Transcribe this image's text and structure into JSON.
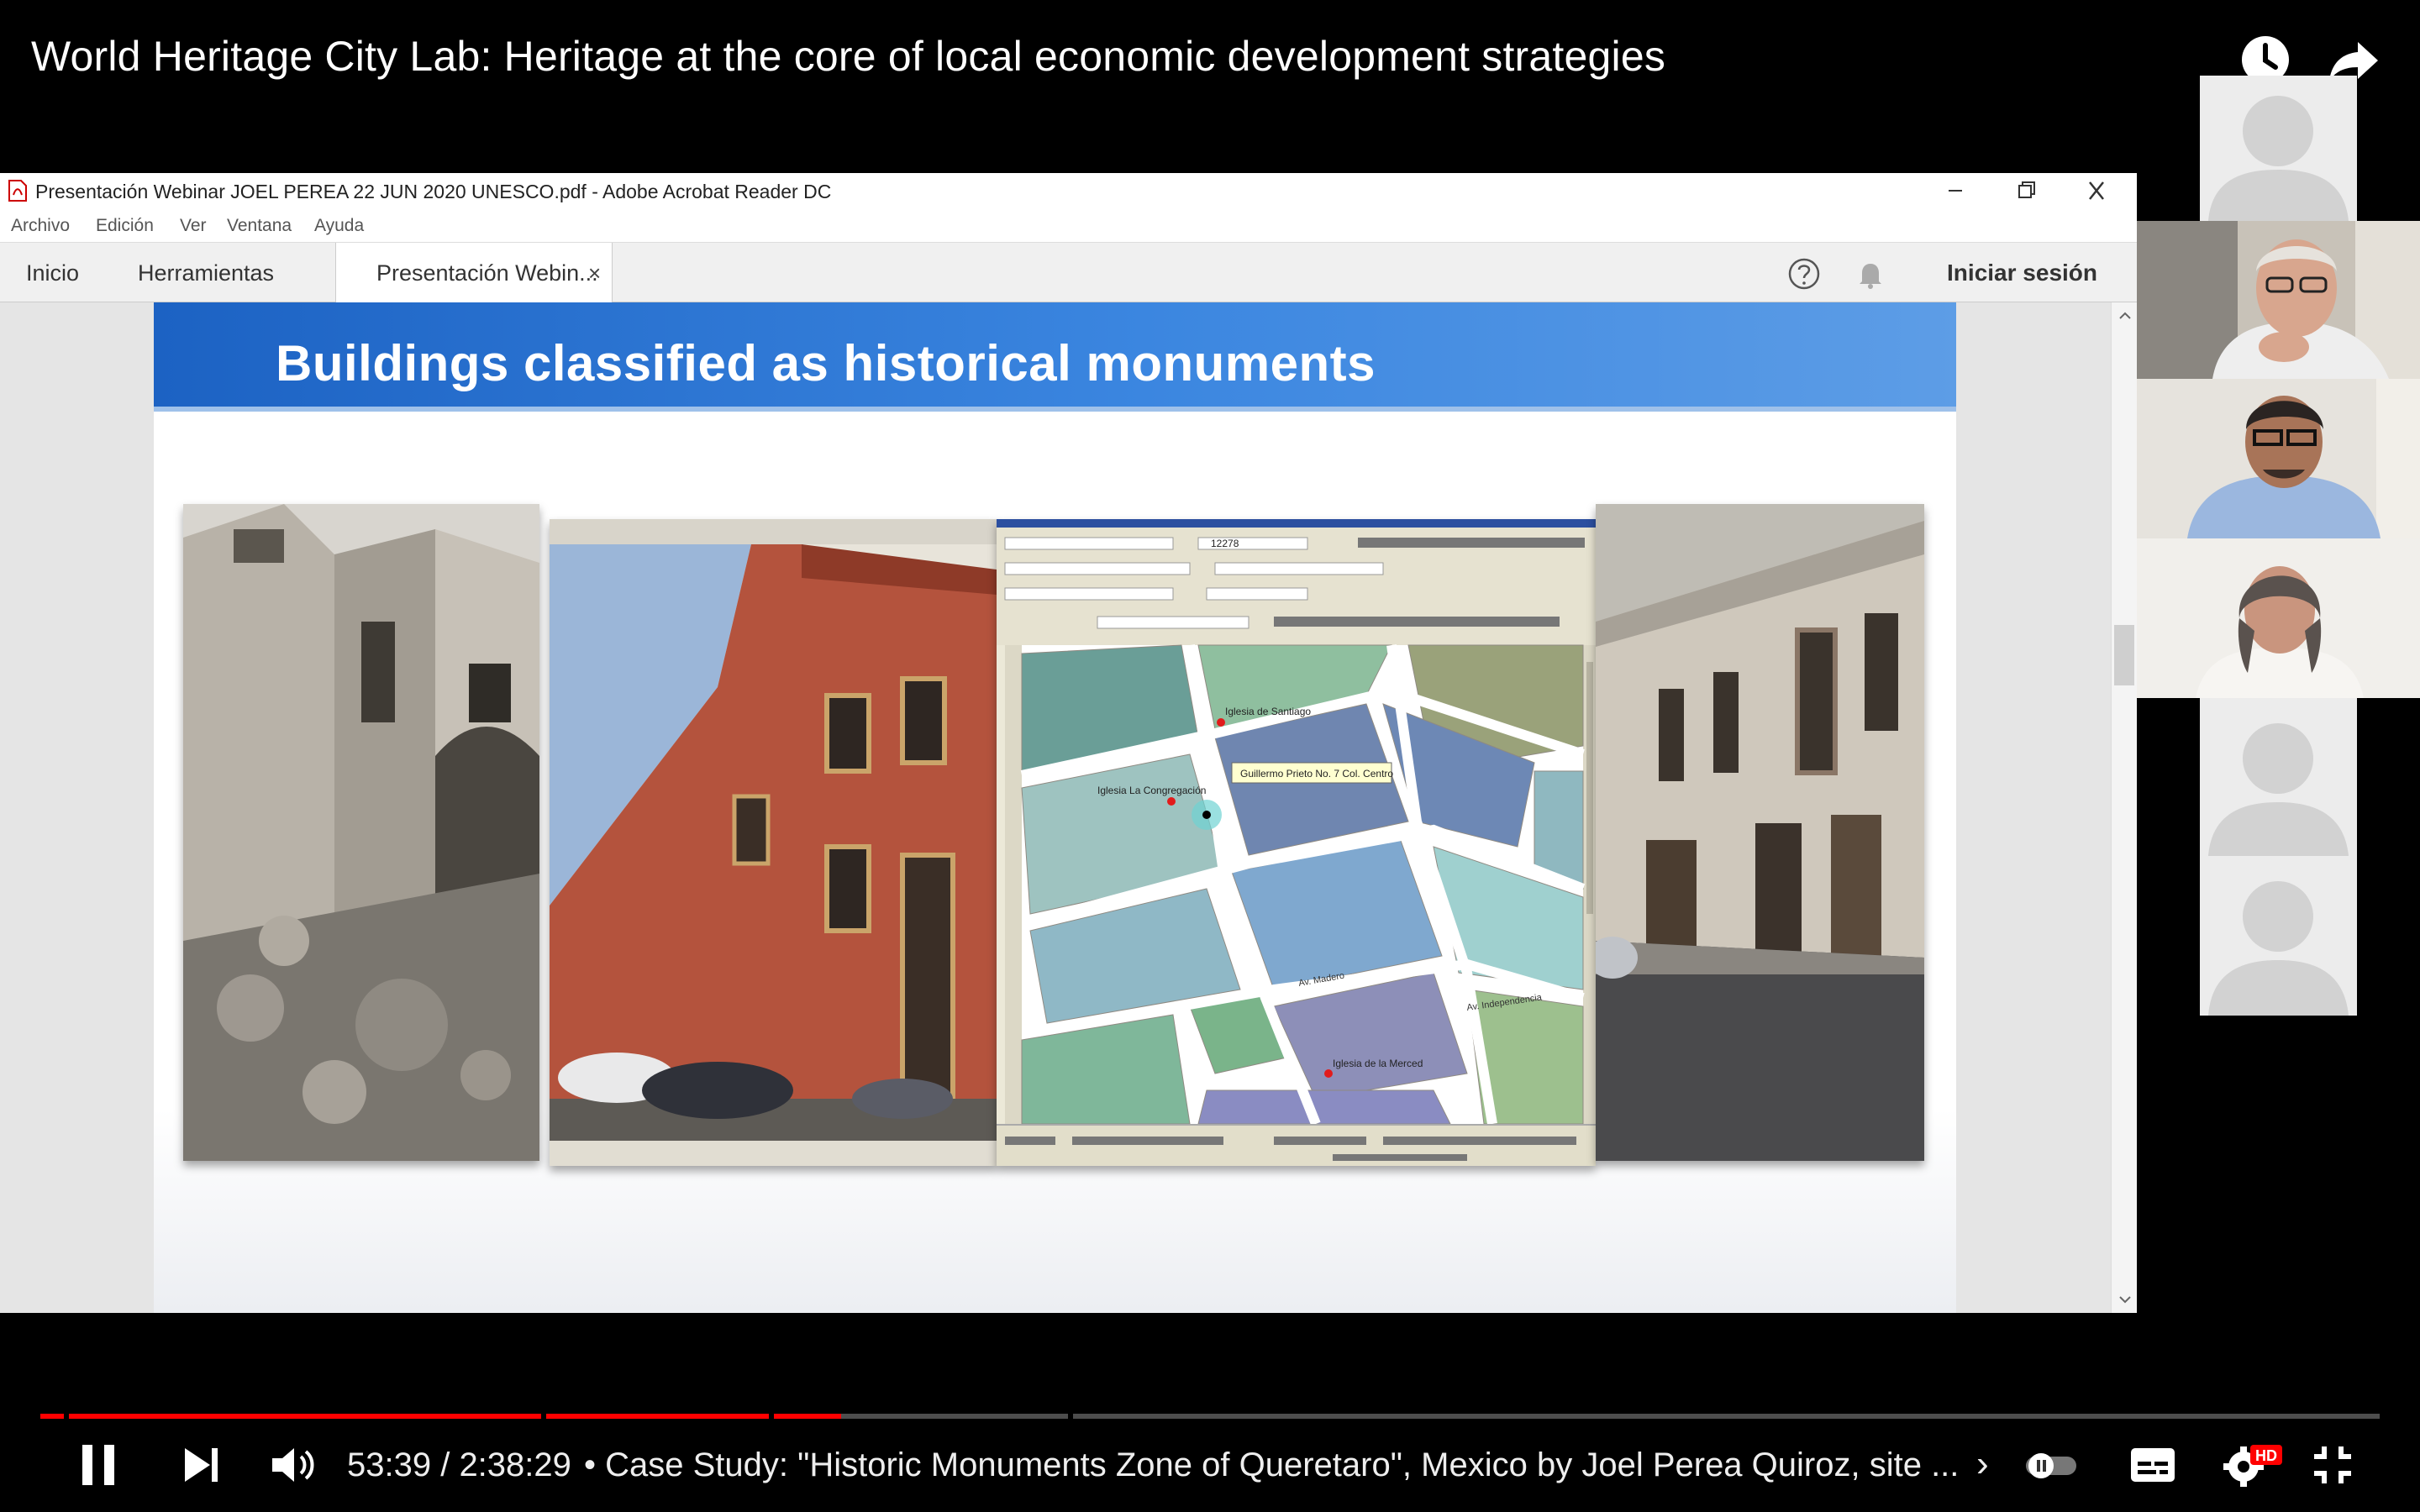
{
  "video": {
    "title": "World Heritage City Lab: Heritage at the core of local economic development strategies",
    "watch_later_icon": "clock-icon",
    "share_icon": "share-arrow-icon"
  },
  "acrobat": {
    "window_title": "Presentación Webinar JOEL PEREA 22 JUN 2020 UNESCO.pdf - Adobe Acrobat Reader DC",
    "menu": [
      "Archivo",
      "Edición",
      "Ver",
      "Ventana",
      "Ayuda"
    ],
    "tabs": {
      "home": "Inicio",
      "tools": "Herramientas",
      "document": "Presentación Webin...",
      "close": "×"
    },
    "sign_in": "Iniciar sesión"
  },
  "slide": {
    "title": "Buildings classified as historical monuments",
    "map_labels": {
      "santiago": "Iglesia de Santiago",
      "congregacion": "Iglesia La Congregación",
      "address": "Guillermo Prieto No. 7 Col. Centro",
      "street_independencia": "Av. Independencia",
      "street_madero": "Av. Madero",
      "iglesia_bottom": "Iglesia de la Merced",
      "scale": "12278"
    }
  },
  "participants": [
    {
      "type": "placeholder"
    },
    {
      "type": "camera"
    },
    {
      "type": "camera"
    },
    {
      "type": "camera"
    },
    {
      "type": "placeholder"
    },
    {
      "type": "placeholder"
    }
  ],
  "player": {
    "time": "53:39 / 2:38:29",
    "chapter": "• Case Study: \"Historic Monuments Zone of Queretaro\", Mexico by Joel Perea Quiroz, site ...",
    "chevron": "›",
    "progress_fraction": 0.339,
    "hd_badge": "HD",
    "accent": "#ff0000"
  }
}
